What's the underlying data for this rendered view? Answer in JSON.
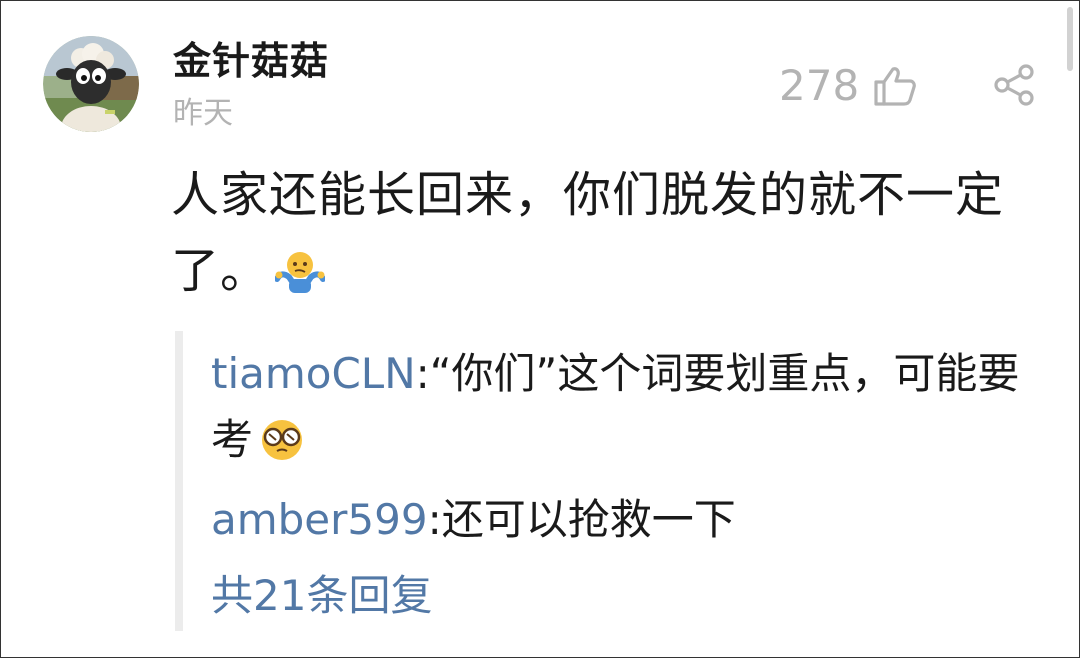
{
  "comment": {
    "username": "金针菇菇",
    "time": "昨天",
    "like_count": "278",
    "text": "人家还能长回来，你们脱发的就不一定了。",
    "emoji": "shrug-emoji"
  },
  "replies": [
    {
      "user": "tiamoCLN",
      "separator": ":",
      "text": "“你们”这个词要划重点，可能要考",
      "emoji": "glasses-emoji"
    },
    {
      "user": "amber599",
      "separator": ":",
      "text": "还可以抢救一下"
    }
  ],
  "more_replies": "共21条回复",
  "icons": {
    "like": "thumbs-up-icon",
    "share": "share-icon"
  },
  "colors": {
    "link_blue": "#5278a6",
    "muted_gray": "#b3b3b3",
    "text_dark": "#1a1a1a",
    "thread_line": "#ececec"
  }
}
